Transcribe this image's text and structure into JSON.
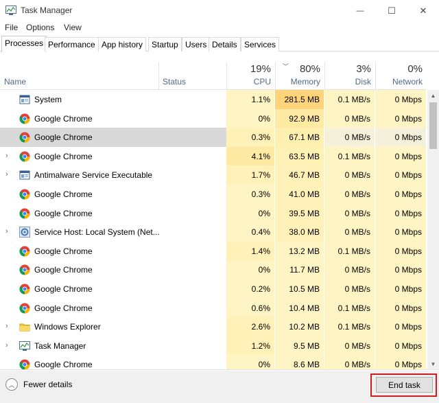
{
  "window": {
    "title": "Task Manager",
    "controls": {
      "minimize": "—",
      "maximize": "☐",
      "close": "✕"
    }
  },
  "menu": [
    "File",
    "Options",
    "View"
  ],
  "tabs": [
    "Processes",
    "Performance",
    "App history",
    "Startup",
    "Users",
    "Details",
    "Services"
  ],
  "active_tab": "Processes",
  "columns": {
    "name": "Name",
    "status": "Status",
    "cpu": {
      "percent": "19%",
      "label": "CPU"
    },
    "memory": {
      "percent": "80%",
      "label": "Memory"
    },
    "disk": {
      "percent": "3%",
      "label": "Disk"
    },
    "network": {
      "percent": "0%",
      "label": "Network"
    }
  },
  "processes": [
    {
      "name": "System",
      "icon": "system-icon",
      "expandable": false,
      "cpu": "1.1%",
      "memory": "281.5 MB",
      "disk": "0.1 MB/s",
      "network": "0 Mbps",
      "cpu_bg": "#fff4c4",
      "mem_bg": "#ffd37a",
      "disk_bg": "#fff4c4",
      "net_bg": "#fff4c4"
    },
    {
      "name": "Google Chrome",
      "icon": "chrome-icon",
      "expandable": false,
      "cpu": "0%",
      "memory": "92.9 MB",
      "disk": "0 MB/s",
      "network": "0 Mbps",
      "cpu_bg": "#fff4c4",
      "mem_bg": "#ffe9a3",
      "disk_bg": "#fff4c4",
      "net_bg": "#fff4c4"
    },
    {
      "name": "Google Chrome",
      "icon": "chrome-icon",
      "expandable": false,
      "selected": true,
      "cpu": "0.3%",
      "memory": "67.1 MB",
      "disk": "0 MB/s",
      "network": "0 Mbps",
      "cpu_bg": "#fff1b8",
      "mem_bg": "#fff0b0",
      "disk_bg": "#f4f0da",
      "net_bg": "#f4f0da"
    },
    {
      "name": "Google Chrome",
      "icon": "chrome-icon",
      "expandable": true,
      "cpu": "4.1%",
      "memory": "63.5 MB",
      "disk": "0.1 MB/s",
      "network": "0 Mbps",
      "cpu_bg": "#ffeaa3",
      "mem_bg": "#fff0b3",
      "disk_bg": "#fff4c4",
      "net_bg": "#fff4c4"
    },
    {
      "name": "Antimalware Service Executable",
      "icon": "antimalware-icon",
      "expandable": true,
      "cpu": "1.7%",
      "memory": "46.7 MB",
      "disk": "0 MB/s",
      "network": "0 Mbps",
      "cpu_bg": "#fff1b8",
      "mem_bg": "#fff1b8",
      "disk_bg": "#fff4c4",
      "net_bg": "#fff4c4"
    },
    {
      "name": "Google Chrome",
      "icon": "chrome-icon",
      "expandable": false,
      "cpu": "0.3%",
      "memory": "41.0 MB",
      "disk": "0 MB/s",
      "network": "0 Mbps",
      "cpu_bg": "#fff4c4",
      "mem_bg": "#fff1b8",
      "disk_bg": "#fff4c4",
      "net_bg": "#fff4c4"
    },
    {
      "name": "Google Chrome",
      "icon": "chrome-icon",
      "expandable": false,
      "cpu": "0%",
      "memory": "39.5 MB",
      "disk": "0 MB/s",
      "network": "0 Mbps",
      "cpu_bg": "#fff4c4",
      "mem_bg": "#fff1b8",
      "disk_bg": "#fff4c4",
      "net_bg": "#fff4c4"
    },
    {
      "name": "Service Host: Local System (Net...",
      "icon": "service-host-icon",
      "expandable": true,
      "cpu": "0.4%",
      "memory": "38.0 MB",
      "disk": "0 MB/s",
      "network": "0 Mbps",
      "cpu_bg": "#fff4c4",
      "mem_bg": "#fff1b8",
      "disk_bg": "#fff4c4",
      "net_bg": "#fff4c4"
    },
    {
      "name": "Google Chrome",
      "icon": "chrome-icon",
      "expandable": false,
      "cpu": "1.4%",
      "memory": "13.2 MB",
      "disk": "0.1 MB/s",
      "network": "0 Mbps",
      "cpu_bg": "#fff1b8",
      "mem_bg": "#fff4c4",
      "disk_bg": "#fff4c4",
      "net_bg": "#fff4c4"
    },
    {
      "name": "Google Chrome",
      "icon": "chrome-icon",
      "expandable": false,
      "cpu": "0%",
      "memory": "11.7 MB",
      "disk": "0 MB/s",
      "network": "0 Mbps",
      "cpu_bg": "#fff4c4",
      "mem_bg": "#fff4c4",
      "disk_bg": "#fff4c4",
      "net_bg": "#fff4c4"
    },
    {
      "name": "Google Chrome",
      "icon": "chrome-icon",
      "expandable": false,
      "cpu": "0.2%",
      "memory": "10.5 MB",
      "disk": "0 MB/s",
      "network": "0 Mbps",
      "cpu_bg": "#fff4c4",
      "mem_bg": "#fff4c4",
      "disk_bg": "#fff4c4",
      "net_bg": "#fff4c4"
    },
    {
      "name": "Google Chrome",
      "icon": "chrome-icon",
      "expandable": false,
      "cpu": "0.6%",
      "memory": "10.4 MB",
      "disk": "0.1 MB/s",
      "network": "0 Mbps",
      "cpu_bg": "#fff4c4",
      "mem_bg": "#fff4c4",
      "disk_bg": "#fff4c4",
      "net_bg": "#fff4c4"
    },
    {
      "name": "Windows Explorer",
      "icon": "folder-icon",
      "expandable": true,
      "cpu": "2.6%",
      "memory": "10.2 MB",
      "disk": "0.1 MB/s",
      "network": "0 Mbps",
      "cpu_bg": "#fff1b8",
      "mem_bg": "#fff4c4",
      "disk_bg": "#fff4c4",
      "net_bg": "#fff4c4"
    },
    {
      "name": "Task Manager",
      "icon": "task-manager-icon",
      "expandable": true,
      "cpu": "1.2%",
      "memory": "9.5 MB",
      "disk": "0 MB/s",
      "network": "0 Mbps",
      "cpu_bg": "#fff1b8",
      "mem_bg": "#fff4c4",
      "disk_bg": "#fff4c4",
      "net_bg": "#fff4c4"
    },
    {
      "name": "Google Chrome",
      "icon": "chrome-icon",
      "expandable": false,
      "cpu": "0%",
      "memory": "8.6 MB",
      "disk": "0 MB/s",
      "network": "0 Mbps",
      "cpu_bg": "#fff4c4",
      "mem_bg": "#fff4c4",
      "disk_bg": "#fff4c4",
      "net_bg": "#fff4c4"
    }
  ],
  "footer": {
    "fewer_details": "Fewer details",
    "end_task": "End task"
  }
}
